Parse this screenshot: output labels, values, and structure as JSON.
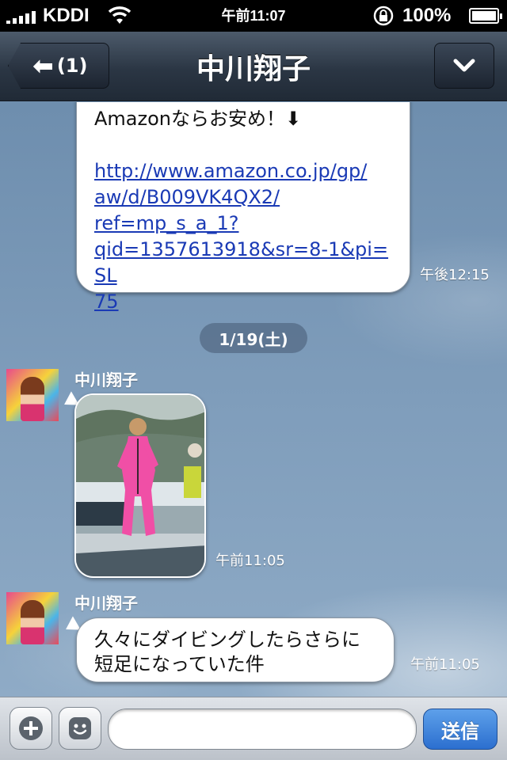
{
  "status_bar": {
    "carrier": "KDDI",
    "time": "午前11:07",
    "battery": "100%"
  },
  "nav": {
    "back_label": "(1)",
    "title": "中川翔子"
  },
  "messages": {
    "outgoing_partial": {
      "text": "Amazonならお安め！⬇",
      "link_lines": [
        "http://www.amazon.co.jp/gp/",
        "aw/d/B009VK4QX2/",
        "ref=mp_s_a_1?",
        "qid=1357613918&sr=8-1&pi=SL",
        "75"
      ],
      "time": "午後12:15"
    },
    "date_separator": "1/19(土)",
    "photo_message": {
      "sender": "中川翔子",
      "time": "午前11:05"
    },
    "text_message": {
      "sender": "中川翔子",
      "line1": "久々にダイビングしたらさらに",
      "line2": "短足になっていた件",
      "time": "午前11:05"
    }
  },
  "input_bar": {
    "placeholder": "",
    "send_label": "送信"
  },
  "colors": {
    "link": "#1a3ab5",
    "send_button": "#2c6fcf",
    "nav_bar": "#2b3644"
  }
}
